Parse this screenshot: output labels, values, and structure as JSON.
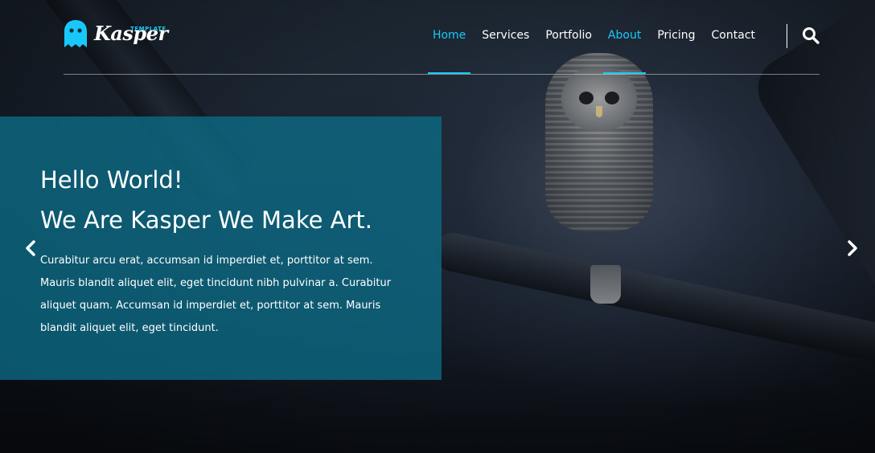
{
  "logo": {
    "name": "Kasper",
    "tagline": "TEMPLATE",
    "icon": "ghost-icon"
  },
  "nav": {
    "items": [
      {
        "label": "Home",
        "active": true
      },
      {
        "label": "Services",
        "active": false
      },
      {
        "label": "Portfolio",
        "active": false
      },
      {
        "label": "About",
        "active": true
      },
      {
        "label": "Pricing",
        "active": false
      },
      {
        "label": "Contact",
        "active": false
      }
    ],
    "search_icon": "search-icon"
  },
  "hero": {
    "headline_line1": "Hello World!",
    "headline_line2": "We Are Kasper We Make Art.",
    "body": "Curabitur arcu erat, accumsan id imperdiet et, porttitor at sem. Mauris blandit aliquet elit, eget tincidunt nibh pulvinar a. Curabitur aliquet quam. Accumsan id imperdiet et, porttitor at sem. Mauris blandit aliquet elit, eget tincidunt.",
    "prev_icon": "chevron-left-icon",
    "next_icon": "chevron-right-icon"
  },
  "colors": {
    "accent": "#19c8fa",
    "panel": "#0b6b87",
    "text": "#ffffff"
  }
}
